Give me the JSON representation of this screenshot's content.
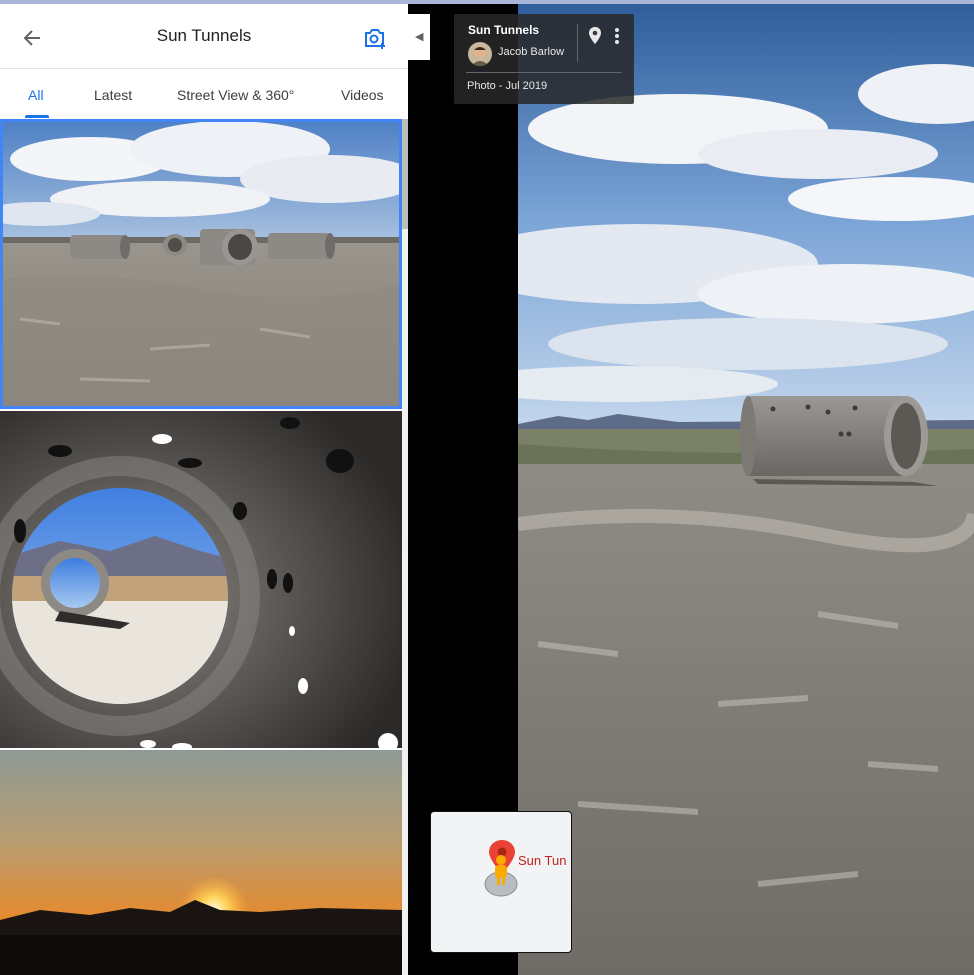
{
  "panel": {
    "title": "Sun Tunnels",
    "back_icon": "arrow-left-icon",
    "add_photo_icon": "camera-plus-icon",
    "tabs": [
      {
        "label": "All",
        "active": true
      },
      {
        "label": "Latest",
        "active": false
      },
      {
        "label": "Street View & 360°",
        "active": false
      },
      {
        "label": "Videos",
        "active": false
      }
    ],
    "accent_color": "#1a73e8"
  },
  "photo_card": {
    "title": "Sun Tunnels",
    "author": "Jacob Barlow",
    "date": "Photo - Jul 2019"
  },
  "minimap": {
    "label": "Sun Tun"
  }
}
